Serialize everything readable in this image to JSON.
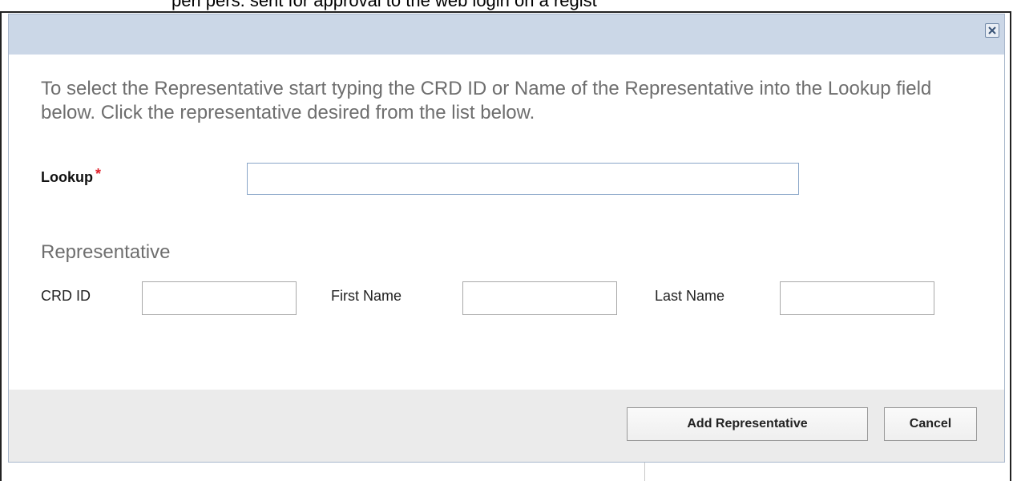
{
  "background_text": "peri    pers. sent for approval to the web login on a regist",
  "dialog": {
    "close_glyph": "✕",
    "instructions": "To select the Representative start typing the CRD ID or Name of the Representative into the Lookup field below. Click the representative desired from the list below.",
    "lookup": {
      "label": "Lookup",
      "required_marker": "*",
      "value": ""
    },
    "representative": {
      "heading": "Representative",
      "crd_id": {
        "label": "CRD ID",
        "value": ""
      },
      "first_name": {
        "label": "First Name",
        "value": ""
      },
      "last_name": {
        "label": "Last Name",
        "value": ""
      }
    },
    "buttons": {
      "add": "Add Representative",
      "cancel": "Cancel"
    }
  },
  "colors": {
    "titlebar": "#cbd7e7",
    "footer": "#ebebeb",
    "required": "#e0202a",
    "input_focus_border": "#8aa6c8"
  }
}
